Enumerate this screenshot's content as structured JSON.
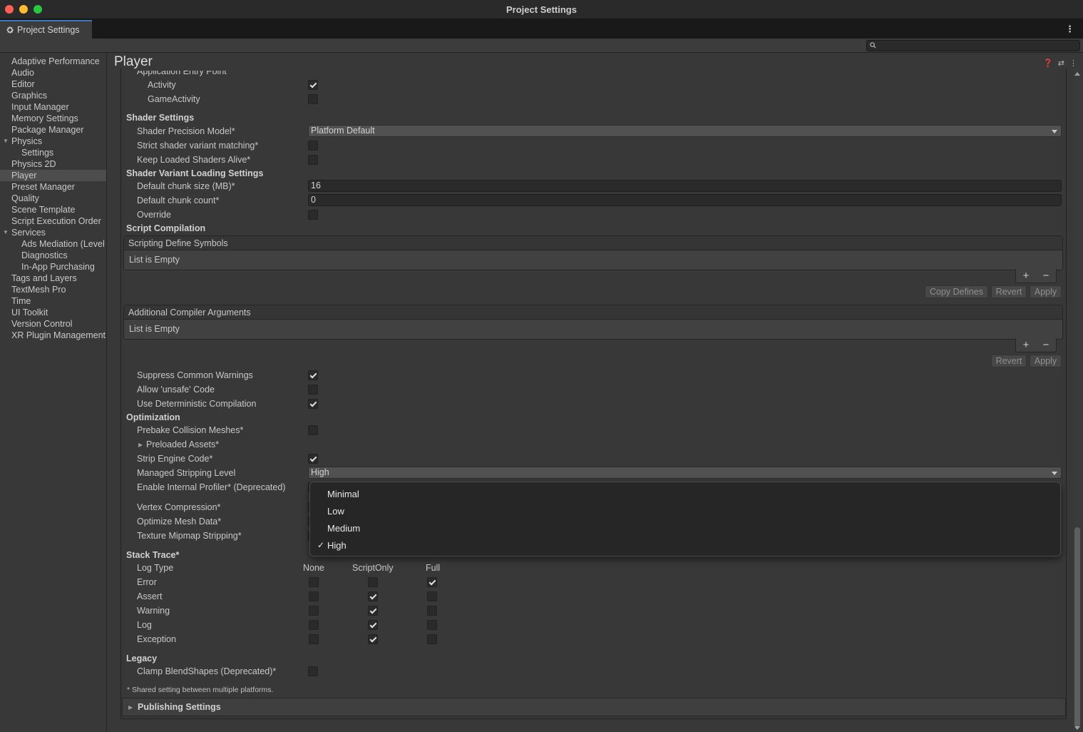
{
  "window": {
    "title": "Project Settings"
  },
  "tab": {
    "label": "Project Settings",
    "icon": "gear-icon"
  },
  "search": {
    "placeholder": ""
  },
  "sidebar": {
    "items": [
      {
        "label": "Adaptive Performance"
      },
      {
        "label": "Audio"
      },
      {
        "label": "Editor"
      },
      {
        "label": "Graphics"
      },
      {
        "label": "Input Manager"
      },
      {
        "label": "Memory Settings"
      },
      {
        "label": "Package Manager"
      },
      {
        "label": "Physics"
      },
      {
        "label": "Settings"
      },
      {
        "label": "Physics 2D"
      },
      {
        "label": "Player"
      },
      {
        "label": "Preset Manager"
      },
      {
        "label": "Quality"
      },
      {
        "label": "Scene Template"
      },
      {
        "label": "Script Execution Order"
      },
      {
        "label": "Services"
      },
      {
        "label": "Ads Mediation (Level"
      },
      {
        "label": "Diagnostics"
      },
      {
        "label": "In-App Purchasing"
      },
      {
        "label": "Tags and Layers"
      },
      {
        "label": "TextMesh Pro"
      },
      {
        "label": "Time"
      },
      {
        "label": "UI Toolkit"
      },
      {
        "label": "Version Control"
      },
      {
        "label": "XR Plugin Management"
      }
    ],
    "selected": "Player"
  },
  "main": {
    "title": "Player",
    "app_entry": {
      "header": "Application Entry Point",
      "activity": {
        "label": "Activity",
        "checked": true
      },
      "game_activity": {
        "label": "GameActivity",
        "checked": false
      }
    },
    "shader_settings": {
      "header": "Shader Settings",
      "precision_label": "Shader Precision Model*",
      "precision_value": "Platform Default",
      "strict_label": "Strict shader variant matching*",
      "keep_loaded_label": "Keep Loaded Shaders Alive*"
    },
    "shader_variant": {
      "header": "Shader Variant Loading Settings",
      "chunk_size_label": "Default chunk size (MB)*",
      "chunk_size_value": "16",
      "chunk_count_label": "Default chunk count*",
      "chunk_count_value": "0",
      "override_label": "Override"
    },
    "script_compilation": {
      "header": "Script Compilation",
      "define_symbols_header": "Scripting Define Symbols",
      "define_symbols_empty": "List is Empty",
      "copy_defines": "Copy Defines",
      "revert": "Revert",
      "apply": "Apply",
      "compiler_args_header": "Additional Compiler Arguments",
      "compiler_args_empty": "List is Empty",
      "plus": "+",
      "minus": "−",
      "suppress_warnings": {
        "label": "Suppress Common Warnings",
        "checked": true
      },
      "unsafe_code": {
        "label": "Allow 'unsafe' Code",
        "checked": false
      },
      "deterministic": {
        "label": "Use Deterministic Compilation",
        "checked": true
      }
    },
    "optimization": {
      "header": "Optimization",
      "prebake": {
        "label": "Prebake Collision Meshes*",
        "checked": false
      },
      "preloaded_assets": "Preloaded Assets*",
      "strip_engine": {
        "label": "Strip Engine Code*",
        "checked": true
      },
      "managed_stripping_label": "Managed Stripping Level",
      "managed_stripping_value": "High",
      "internal_profiler": "Enable Internal Profiler* (Deprecated)",
      "vertex_compression": "Vertex Compression*",
      "optimize_mesh": "Optimize Mesh Data*",
      "mipmap_stripping": "Texture Mipmap Stripping*"
    },
    "stripping_popup": {
      "options": [
        "Minimal",
        "Low",
        "Medium",
        "High"
      ],
      "selected": "High",
      "checkmark": "✓"
    },
    "stack_trace": {
      "header": "Stack Trace*",
      "log_type_label": "Log Type",
      "columns": [
        "None",
        "ScriptOnly",
        "Full"
      ],
      "rows": [
        {
          "label": "Error",
          "selected": "Full"
        },
        {
          "label": "Assert",
          "selected": "ScriptOnly"
        },
        {
          "label": "Warning",
          "selected": "ScriptOnly"
        },
        {
          "label": "Log",
          "selected": "ScriptOnly"
        },
        {
          "label": "Exception",
          "selected": "ScriptOnly"
        }
      ]
    },
    "legacy": {
      "header": "Legacy",
      "clamp_blendshapes": {
        "label": "Clamp BlendShapes (Deprecated)*",
        "checked": false
      }
    },
    "footnote": "* Shared setting between multiple platforms.",
    "publishing_settings": "Publishing Settings"
  },
  "colors": {
    "accent": "#3a79bb",
    "panel": "#383838",
    "selection": "#4d4d4d"
  }
}
